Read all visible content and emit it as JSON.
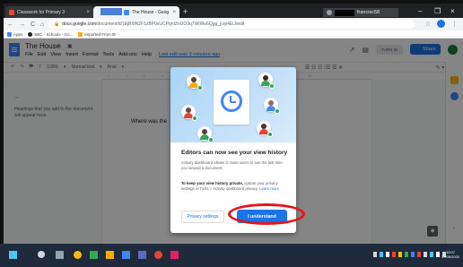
{
  "browser": {
    "tabs": [
      {
        "label": "Classwork for Primary 3",
        "close": "×"
      },
      {
        "label": "The House - Goog",
        "close": "×"
      }
    ],
    "new_tab": "+",
    "user_name": "francisc58",
    "window_controls": {
      "minimize": "–",
      "restore": "❐",
      "close": "×"
    },
    "nav": {
      "back": "←",
      "forward": "→",
      "reload": "C",
      "home": "⌂"
    },
    "url_host": "docs.google.com",
    "url_path": "/document/d/1EjBI9N2F1zBP0vUCPqnIZnUO3q7WIWu6Qgg_jcrp4ElJ/edit",
    "star": "☆",
    "menu_dots": "⋮",
    "bookmarks": [
      {
        "label": "Apps",
        "color": "#4285f4"
      },
      {
        "label": "SBC - Schools - Go...",
        "color": "#202124"
      },
      {
        "label": "Imported From IE",
        "color": "#f9ab00"
      }
    ]
  },
  "docs": {
    "title": "The House",
    "title_icons": "☆ ▣",
    "menu": [
      "File",
      "Edit",
      "View",
      "Insert",
      "Format",
      "Tools",
      "Add-ons",
      "Help"
    ],
    "last_edit": "Last edit was 3 minutes ago",
    "turn_in": "TURN IN",
    "share_label": "Share",
    "toolbar_items": [
      "↶",
      "↷",
      "🖶",
      "T",
      "100%",
      "▾",
      "Normal text",
      "▾",
      "Arial",
      "▾"
    ],
    "toolbar_right": "☰ ☷ ☷ ⁝☰ ☰ ✕",
    "toolbar_far": "✎ ▾ ⌃",
    "ruler_marks": [
      "1",
      "2",
      "3",
      "4",
      "5",
      "6",
      "7",
      "8",
      "9",
      "10",
      "11",
      "12"
    ],
    "outline_back": "←",
    "outline_text": "Headings that you add to the document will appear here.",
    "page_text": "Where was the"
  },
  "dialog": {
    "title": "Editors can now see your view history",
    "body1": "Activity dashboard allows G Suite users to see the last time you viewed a document.",
    "body2_bold": "To keep your view history private,",
    "body2": " update your privacy settings in Tools > Activity dashboard privacy.",
    "learn_more": "Learn more",
    "privacy_button": "Privacy settings",
    "understand_button": "I understand"
  },
  "taskbar": {
    "time": "10:07",
    "date": "17/05/2020"
  },
  "colors": {
    "accent": "#1a73e8",
    "highlight_ring": "#e8141b",
    "overlay": "rgba(0,0,0,0.48)"
  }
}
